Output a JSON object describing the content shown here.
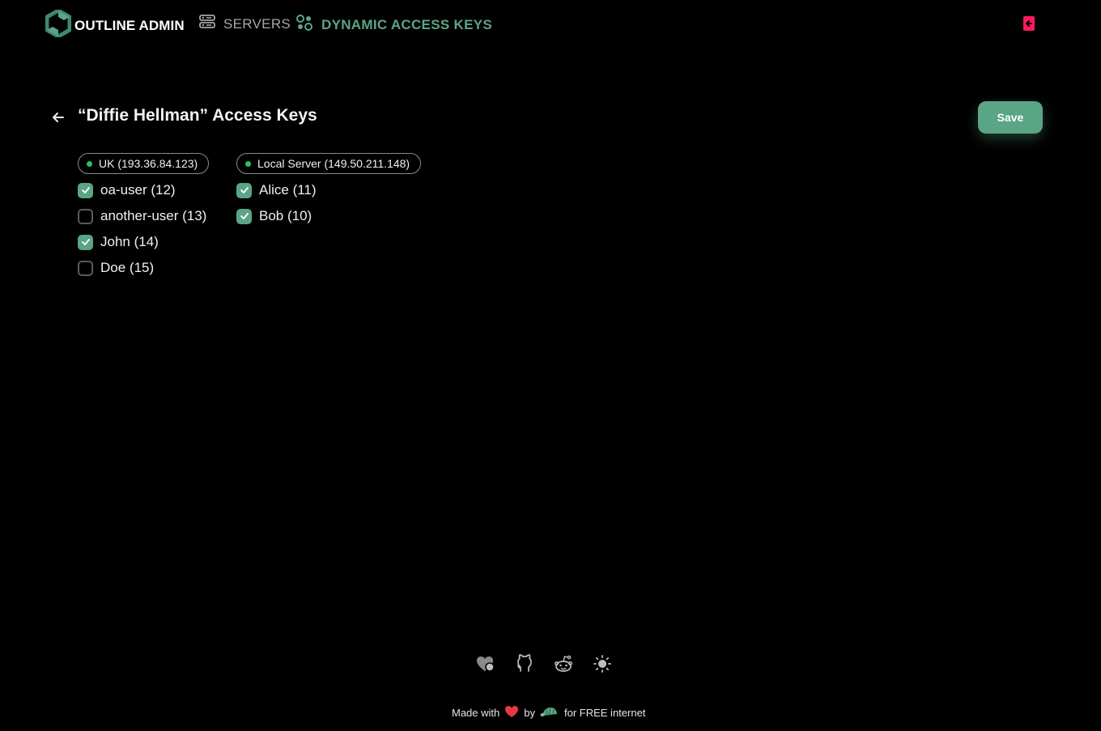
{
  "header": {
    "brand": "OUTLINE ADMIN",
    "nav": {
      "servers": "SERVERS",
      "dynamic_access_keys": "DYNAMIC ACCESS KEYS"
    }
  },
  "page": {
    "title": "“Diffie Hellman” Access Keys",
    "save_label": "Save"
  },
  "servers": [
    {
      "label": "UK (193.36.84.123)",
      "status": "online",
      "keys": [
        {
          "label": "oa-user (12)",
          "checked": true
        },
        {
          "label": "another-user (13)",
          "checked": false
        },
        {
          "label": "John (14)",
          "checked": true
        },
        {
          "label": "Doe (15)",
          "checked": false
        }
      ]
    },
    {
      "label": "Local Server (149.50.211.148)",
      "status": "online",
      "keys": [
        {
          "label": "Alice (11)",
          "checked": true
        },
        {
          "label": "Bob (10)",
          "checked": true
        }
      ]
    }
  ],
  "footer": {
    "icons": [
      "donate-heart-icon",
      "github-icon",
      "reddit-icon",
      "theme-sun-icon"
    ],
    "made_with": "Made with",
    "by": "by",
    "tagline": "for FREE internet"
  },
  "colors": {
    "accent": "#5aa585",
    "background": "#000000",
    "online": "#22c55e",
    "logout": "#ff1a5c",
    "heart": "#e53946"
  }
}
